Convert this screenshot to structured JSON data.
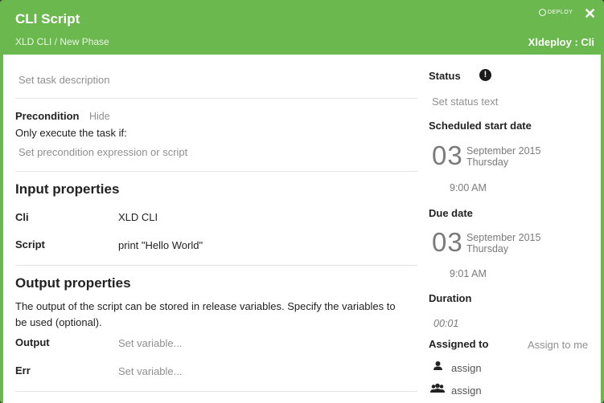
{
  "header": {
    "title": "CLI Script",
    "breadcrumb": "XLD CLI / New Phase",
    "logo_text": "DEPLOY",
    "task_type": "Xldeploy : Cli",
    "close_glyph": "✕"
  },
  "main": {
    "description_placeholder": "Set task description",
    "precondition": {
      "title": "Precondition",
      "toggle": "Hide",
      "help": "Only execute the task if:",
      "placeholder": "Set precondition expression or script"
    },
    "input": {
      "title": "Input properties",
      "cli_label": "Cli",
      "cli_value": "XLD CLI",
      "script_label": "Script",
      "script_value": "print \"Hello World\""
    },
    "output": {
      "title": "Output properties",
      "help_line1": "The output of the script can be stored in release variables. Specify the variables to",
      "help_line2": "be used (optional).",
      "output_label": "Output",
      "output_placeholder": "Set variable...",
      "err_label": "Err",
      "err_placeholder": "Set variable..."
    }
  },
  "sidebar": {
    "status_label": "Status",
    "status_icon_glyph": "!",
    "status_placeholder": "Set status text",
    "scheduled": {
      "label": "Scheduled start date",
      "day": "03",
      "month_year": "September 2015",
      "weekday": "Thursday",
      "time": "9:00 AM"
    },
    "due": {
      "label": "Due date",
      "day": "03",
      "month_year": "September 2015",
      "weekday": "Thursday",
      "time": "9:01 AM"
    },
    "duration_label": "Duration",
    "duration_value": "00:01",
    "assigned_label": "Assigned to",
    "assign_to_me": "Assign to me",
    "assign_user": "assign",
    "assign_team": "assign"
  }
}
